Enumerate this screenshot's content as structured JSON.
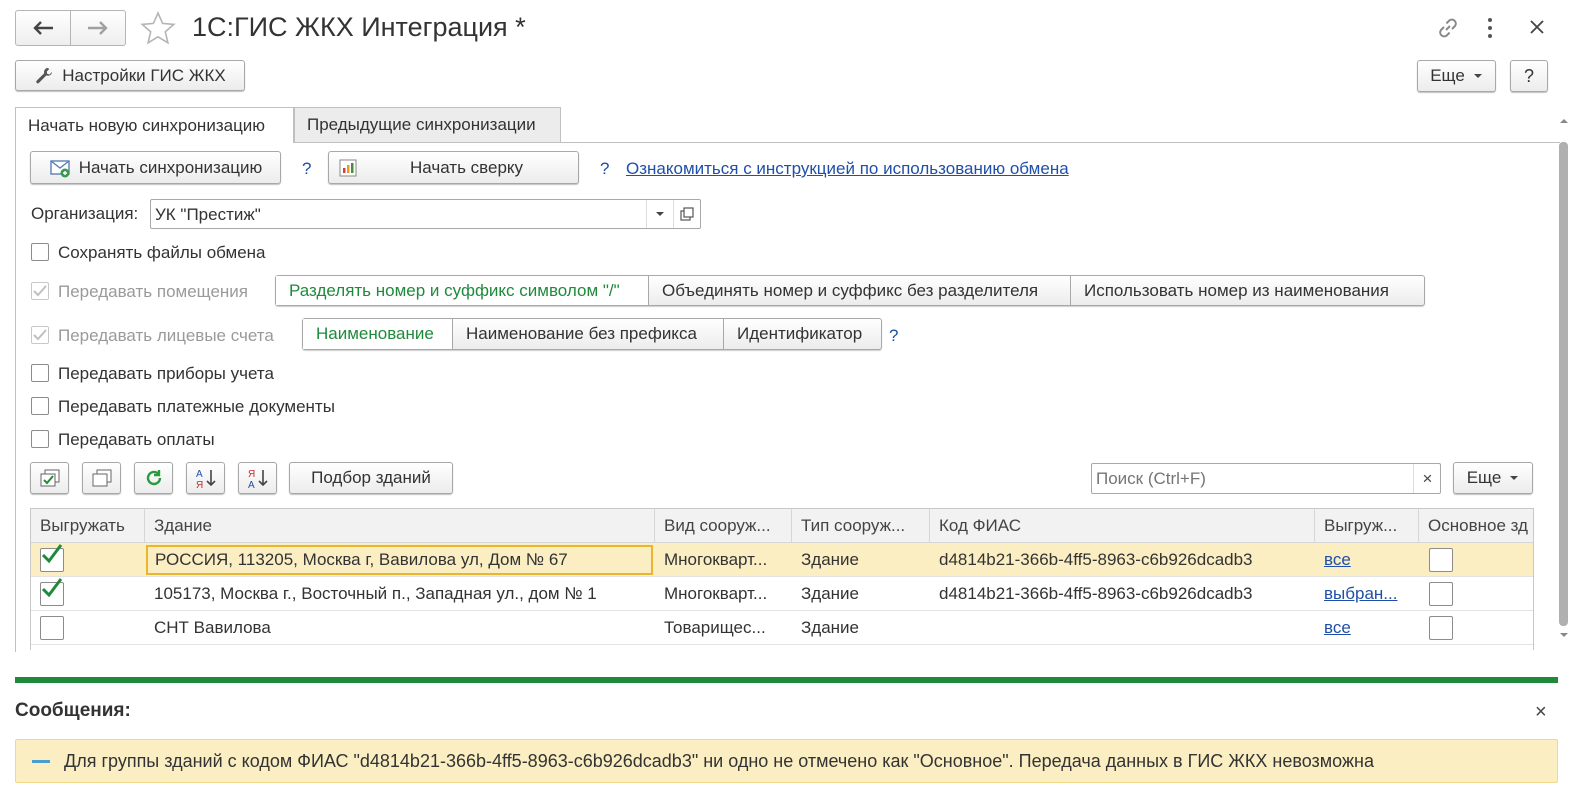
{
  "window": {
    "title": "1С:ГИС ЖКХ Интеграция *"
  },
  "toolbar": {
    "settings_label": "Настройки ГИС ЖКХ",
    "more_label": "Еще",
    "help_label": "?"
  },
  "tabs": [
    {
      "label": "Начать новую синхронизацию"
    },
    {
      "label": "Предыдущие синхронизации"
    }
  ],
  "actions": {
    "start_sync": "Начать синхронизацию",
    "help1": "?",
    "start_check": "Начать сверку",
    "help2": "?",
    "instruction_link": "Ознакомиться с инструкцией по использованию обмена"
  },
  "organization": {
    "label": "Организация:",
    "value": "УК \"Престиж\""
  },
  "options": {
    "save_files": "Сохранять файлы обмена",
    "transfer_rooms": "Передавать помещения",
    "transfer_accounts": "Передавать лицевые счета",
    "transfer_meters": "Передавать приборы учета",
    "transfer_payment_docs": "Передавать платежные документы",
    "transfer_payments": "Передавать оплаты"
  },
  "rooms_modes": [
    "Разделять номер и суффикс символом \"/\"",
    "Объединять номер и суффикс без разделителя",
    "Использовать номер из наименования"
  ],
  "account_modes": [
    "Наименование",
    "Наименование без префикса",
    "Идентификатор"
  ],
  "account_help": "?",
  "table_toolbar": {
    "pick_buildings": "Подбор зданий",
    "search_placeholder": "Поиск (Ctrl+F)",
    "clear": "×",
    "more_label": "Еще"
  },
  "table": {
    "columns": [
      "Выгружать",
      "Здание",
      "Вид сооруж...",
      "Тип сооруж...",
      "Код ФИАС",
      "Выгруж...",
      "Основное зд"
    ],
    "rows": [
      {
        "building": "РОССИЯ, 113205, Москва г, Вавилова ул, Дом № 67",
        "kind": "Многокварт...",
        "type": "Здание",
        "fias": "d4814b21-366b-4ff5-8963-c6b926dcadb3",
        "export": "все"
      },
      {
        "building": "105173, Москва г., Восточный п., Западная ул., дом № 1",
        "kind": "Многокварт...",
        "type": "Здание",
        "fias": "d4814b21-366b-4ff5-8963-c6b926dcadb3",
        "export": "выбран..."
      },
      {
        "building": "СНТ Вавилова",
        "kind": "Товарищес...",
        "type": "Здание",
        "fias": "",
        "export": "все"
      }
    ]
  },
  "messages": {
    "title": "Сообщения:",
    "close": "×",
    "text": "Для группы зданий с кодом ФИАС \"d4814b21-366b-4ff5-8963-c6b926dcadb3\" ни одно не отмечено как \"Основное\". Передача данных в ГИС ЖКХ невозможна"
  },
  "colors": {
    "accent_green": "#1f8a3c",
    "selected_row": "#fbeec2",
    "focus_border": "#e8b730",
    "message_bg": "#fbeec2",
    "link": "#1f4fa8"
  }
}
